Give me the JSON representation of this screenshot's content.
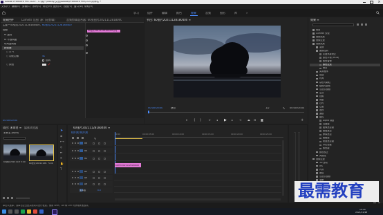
{
  "titlebar": {
    "title": "Adobe Premiere Pro 2020 - C:\\用户\\ifxbxy\\文档\\Adobe\\Premiere Pro\\14.0\\未命名 *"
  },
  "menubar": {
    "items": [
      "文件(F)",
      "编辑(E)",
      "剪辑(C)",
      "序列(S)",
      "标记(M)",
      "图形(G)",
      "视图(V)",
      "窗口(W)",
      "帮助(H)"
    ]
  },
  "workspaces": {
    "items": [
      "学习",
      "组件",
      "编辑",
      "颜色",
      "效果",
      "音频",
      "图形",
      "库"
    ],
    "active": "效果"
  },
  "effect_controls": {
    "tabs": [
      "效果控件",
      "Lumetri 范围",
      "源: (无剪辑)",
      "音频剪辑混合器: 60张图片20211128180400"
    ],
    "source": "主要 * 00张片20211128180400.jpg",
    "seq": "60张片20211128180400",
    "video_label": "视频",
    "fx": [
      {
        "name": "fx 运动"
      },
      {
        "name": "fx 不透明度"
      },
      {
        "name": "时间重映射"
      }
    ],
    "clip_label": "60张片20211128180400.jpg",
    "feather_label": "颜色键",
    "sub_items": [
      {
        "label": "○ ▭ ✎"
      },
      {
        "label": "○ 羽化边缘",
        "value": "40"
      },
      {
        "label": "○ 颜色",
        "value": ""
      }
    ],
    "invert_label": "反转",
    "timecode": "00:00:00:00"
  },
  "program_monitor": {
    "tab": "节目: 60张片20211128180400 ≡",
    "timecode_left": "00:00:00:00",
    "fit": "适合",
    "quality": "1/2",
    "timecode_right": "00:00:05:00"
  },
  "effects_panel": {
    "tab": "效果 ≡",
    "tree": [
      {
        "label": "预设",
        "indent": 0
      },
      {
        "label": "Lumetri 预设",
        "indent": 0
      },
      {
        "label": "音频效果",
        "indent": 0
      },
      {
        "label": "音频过渡",
        "indent": 0
      },
      {
        "label": "视频效果",
        "indent": 0
      },
      {
        "label": "变换",
        "indent": 1
      },
      {
        "label": "图像控制",
        "indent": 1
      },
      {
        "label": "灰度系数校正",
        "indent": 2
      },
      {
        "label": "颜色平衡 (RGB)",
        "indent": 2
      },
      {
        "label": "颜色替换",
        "indent": 2
      },
      {
        "label": "颜色过滤",
        "indent": 2,
        "selected": true
      },
      {
        "label": "黑白",
        "indent": 2
      },
      {
        "label": "实用程序",
        "indent": 1
      },
      {
        "label": "扭曲",
        "indent": 1
      },
      {
        "label": "时间",
        "indent": 1
      },
      {
        "label": "杂色与颗粒",
        "indent": 1
      },
      {
        "label": "模糊与锐化",
        "indent": 1
      },
      {
        "label": "沉浸式视频",
        "indent": 1
      },
      {
        "label": "生成",
        "indent": 1
      },
      {
        "label": "视频",
        "indent": 1
      },
      {
        "label": "调整",
        "indent": 1
      },
      {
        "label": "过时",
        "indent": 1
      },
      {
        "label": "过渡",
        "indent": 1
      },
      {
        "label": "透视",
        "indent": 1
      },
      {
        "label": "通道",
        "indent": 1
      },
      {
        "label": "键控",
        "indent": 1
      },
      {
        "label": "Alpha 调整",
        "indent": 2
      },
      {
        "label": "亮度键",
        "indent": 2
      },
      {
        "label": "图像遮罩键",
        "indent": 2
      },
      {
        "label": "差值遮罩",
        "indent": 2
      },
      {
        "label": "移除遮罩",
        "indent": 2
      },
      {
        "label": "超级键",
        "indent": 2
      },
      {
        "label": "轨道遮罩键",
        "indent": 2
      },
      {
        "label": "非红色键",
        "indent": 2
      },
      {
        "label": "颜色键",
        "indent": 2
      },
      {
        "label": "颜色校正",
        "indent": 1
      },
      {
        "label": "风格化",
        "indent": 1
      },
      {
        "label": "视频过渡",
        "indent": 0
      },
      {
        "label": "3D 运动",
        "indent": 1
      },
      {
        "label": "Iris",
        "indent": 1
      },
      {
        "label": "内滑",
        "indent": 1
      },
      {
        "label": "擦除",
        "indent": 1
      },
      {
        "label": "沉浸式视频",
        "indent": 1
      },
      {
        "label": "溶解",
        "indent": 1
      },
      {
        "label": "缩放",
        "indent": 1
      },
      {
        "label": "页面剥落",
        "indent": 1
      }
    ]
  },
  "project_panel": {
    "tabs": [
      "项目: 未命名 ≡",
      "媒体浏览器"
    ],
    "name": "未命名.prproj",
    "clips": [
      {
        "name": "60张片20211128180400",
        "duration": "5:00"
      },
      {
        "name": "60张片20211128...",
        "duration": "5:00"
      }
    ]
  },
  "timeline": {
    "tab": "60张片20211128180400 ≡",
    "timecode": "00:00:00:00",
    "ruler": [
      "00:00",
      "00:00:05:00",
      "00:00:10:00",
      "00:00:15:00",
      "00:00:20:00",
      "00:00:25:00"
    ],
    "tracks": [
      {
        "name": "V3",
        "clip": ""
      },
      {
        "name": "V2",
        "clip": ""
      },
      {
        "name": "V1",
        "clip": "60张片20211128180400"
      },
      {
        "name": "A1",
        "clip": ""
      },
      {
        "name": "A2",
        "clip": ""
      },
      {
        "name": "A3",
        "clip": ""
      },
      {
        "name": "主声道",
        "value": "0.0"
      }
    ]
  },
  "status": {
    "text": "单击以选择，或单击空白处并拖动以进行框选。使用 Shift、Alt 和 Ctrl 可获得其他选项。"
  },
  "taskbar": {
    "time": "15:43",
    "date": "2021/11/28"
  },
  "watermark": {
    "text": "最需教育"
  },
  "colors": {
    "accent": "#4a8cff",
    "clip": "#e27ad6",
    "watermark": "#2340c0"
  }
}
